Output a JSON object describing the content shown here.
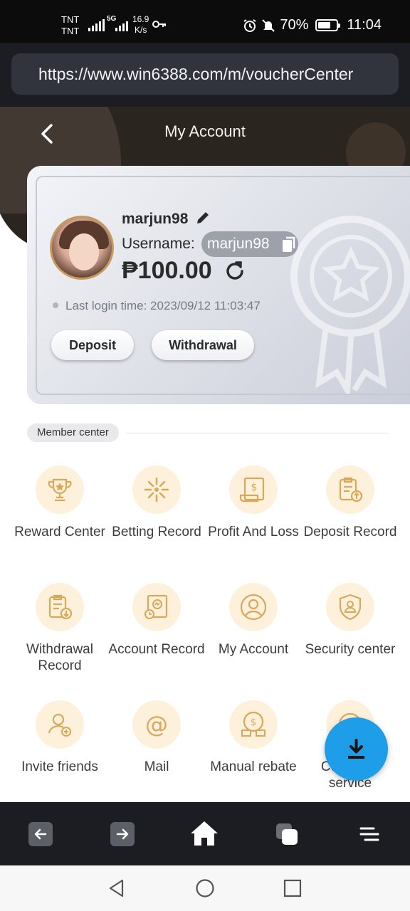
{
  "status_bar": {
    "carrier_1": "TNT",
    "carrier_2": "TNT",
    "network": "5G",
    "speed_value": "16.9",
    "speed_unit": "K/s",
    "battery_percent": "70%",
    "battery_level": 0.7,
    "time": "11:04"
  },
  "browser": {
    "url": "https://www.win6388.com/m/voucherCenter"
  },
  "header": {
    "title": "My Account"
  },
  "account": {
    "nickname": "marjun98",
    "username_label": "Username:",
    "username": "marjun98",
    "balance": "₱100.00",
    "last_login": "Last login time: 2023/09/12 11:03:47",
    "deposit_label": "Deposit",
    "withdrawal_label": "Withdrawal"
  },
  "member_center": {
    "section_label": "Member center",
    "items": [
      {
        "label": "Reward Center",
        "icon": "trophy-icon"
      },
      {
        "label": "Betting Record",
        "icon": "betting-icon"
      },
      {
        "label": "Profit And Loss",
        "icon": "profit-icon"
      },
      {
        "label": "Deposit Record",
        "icon": "deposit-record-icon"
      },
      {
        "label": "Withdrawal Record",
        "icon": "withdrawal-record-icon"
      },
      {
        "label": "Account Record",
        "icon": "account-record-icon"
      },
      {
        "label": "My Account",
        "icon": "user-icon"
      },
      {
        "label": "Security center",
        "icon": "shield-icon"
      },
      {
        "label": "Invite friends",
        "icon": "invite-icon"
      },
      {
        "label": "Mail",
        "icon": "mail-icon"
      },
      {
        "label": "Manual rebate",
        "icon": "rebate-icon"
      },
      {
        "label": "Customer service",
        "icon": "support-icon"
      }
    ]
  },
  "colors": {
    "icon_bg": "#fdf1dc",
    "icon_stroke": "#d9a85a",
    "fab": "#1e9ee8",
    "header_bg": "#2b2520"
  }
}
